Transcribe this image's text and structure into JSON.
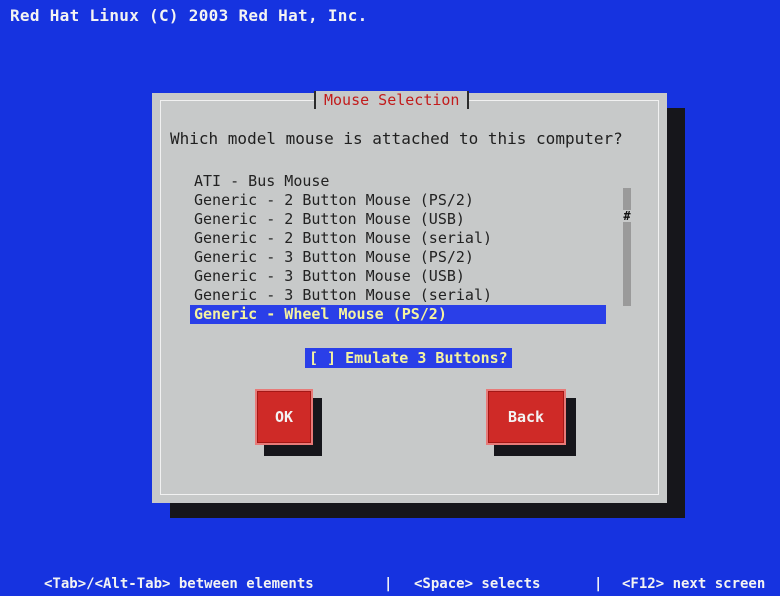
{
  "header": {
    "title": "Red Hat Linux (C) 2003 Red Hat, Inc."
  },
  "dialog": {
    "title": "Mouse Selection",
    "question": "Which model mouse is attached to this computer?",
    "items": [
      "ATI - Bus Mouse",
      "Generic - 2 Button Mouse (PS/2)",
      "Generic - 2 Button Mouse (USB)",
      "Generic - 2 Button Mouse (serial)",
      "Generic - 3 Button Mouse (PS/2)",
      "Generic - 3 Button Mouse (USB)",
      "Generic - 3 Button Mouse (serial)",
      "Generic - Wheel Mouse (PS/2)"
    ],
    "selected_item": "Generic - Wheel Mouse (PS/2)",
    "scrollbar_thumb": "#",
    "checkbox_label": "[ ] Emulate 3 Buttons?",
    "ok_label": "OK",
    "back_label": "Back"
  },
  "footer": {
    "hint_tab": "<Tab>/<Alt-Tab> between elements",
    "sep1": "|",
    "hint_space": "<Space> selects",
    "sep2": "|",
    "hint_f12": "<F12> next screen"
  },
  "colors": {
    "background": "#1633e0",
    "dialog": "#c7c9c9",
    "title_text": "#c21b1b",
    "selection": "#2a3fe8",
    "selection_text": "#f5f3a0",
    "button": "#cf2a27"
  }
}
